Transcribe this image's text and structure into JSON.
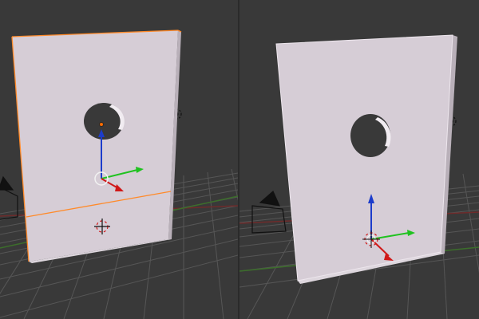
{
  "scene": {
    "viewport_count": 2,
    "viewports": [
      {
        "panel": "left",
        "edit_mode": "edit",
        "edge_loop_selected": true,
        "pivot": "mesh-center"
      },
      {
        "panel": "right",
        "edit_mode": "object",
        "edge_loop_selected": false,
        "pivot": "object-origin"
      }
    ]
  },
  "icons": {
    "lamp": "lamp-icon",
    "camera": "camera-icon",
    "cursor": "3d-cursor-icon",
    "gizmo": "transform-gizmo-icon"
  },
  "colors": {
    "background": "#393939",
    "grid": "#565656",
    "x_axis_line": "#6e2b2b",
    "y_axis_line": "#3c6e2b",
    "plane_face": "#d6cdd6",
    "plane_edge": "#ede6ed",
    "selection_orange": "#ff8a2a",
    "gizmo_x": "#d01818",
    "gizmo_y": "#1fc21f",
    "gizmo_z": "#1c3ccb"
  }
}
